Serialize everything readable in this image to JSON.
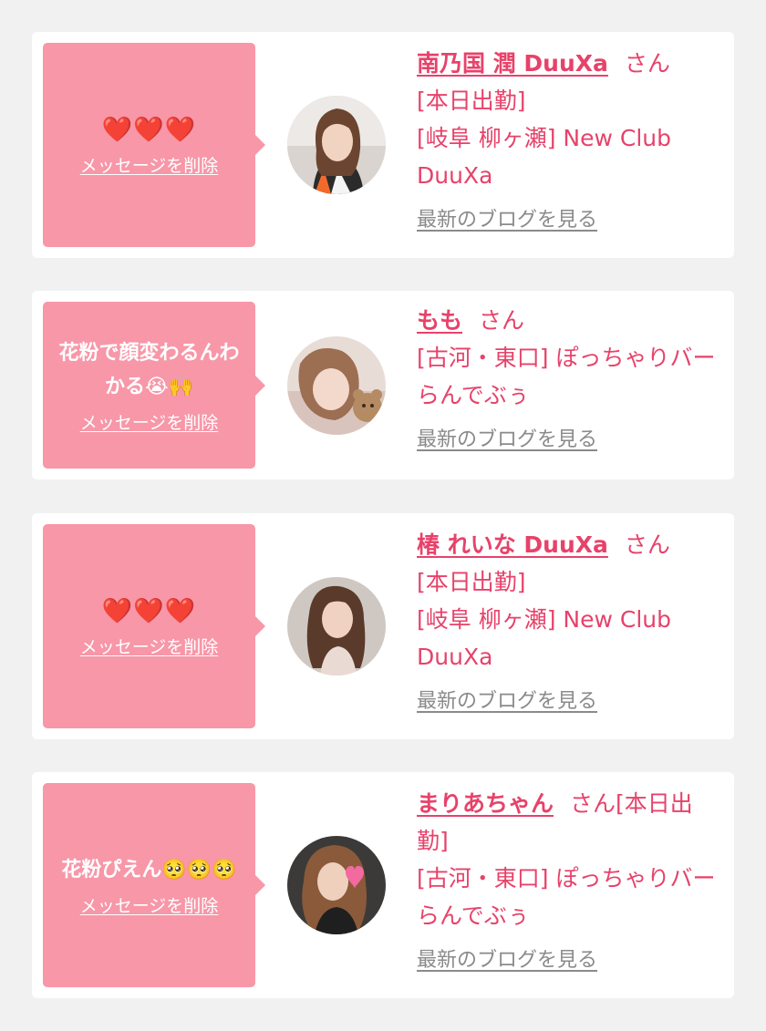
{
  "cards": [
    {
      "message": "❤️❤️❤️",
      "delete_label": "メッセージを削除",
      "name": "南乃国 潤 DuuXa",
      "san": "さん",
      "line1": "[本日出勤]",
      "line2": "[岐阜 柳ヶ瀬] New Club DuuXa",
      "blog_label": "最新のブログを見る"
    },
    {
      "message": "花粉で顔変わるんわかる😭🙌",
      "delete_label": "メッセージを削除",
      "name": "もも",
      "san": "さん",
      "line1": "",
      "line2": "[古河・東口] ぽっちゃりバー らんでぶぅ",
      "blog_label": "最新のブログを見る"
    },
    {
      "message": "❤️❤️❤️",
      "delete_label": "メッセージを削除",
      "name": "椿 れいな DuuXa",
      "san": "さん",
      "line1": "[本日出勤]",
      "line2": "[岐阜 柳ヶ瀬] New Club DuuXa",
      "blog_label": "最新のブログを見る"
    },
    {
      "message": "花粉ぴえん🥺🥺🥺",
      "delete_label": "メッセージを削除",
      "name": "まりあちゃん",
      "san": "さん[本日出勤]",
      "line1": "",
      "line2": "[古河・東口] ぽっちゃりバー らんでぶぅ",
      "blog_label": "最新のブログを見る"
    }
  ],
  "colors": {
    "bubble": "#f797a8",
    "accent_text": "#e7426a",
    "blog_link": "#8a8a8a",
    "background": "#f2f1f1"
  }
}
